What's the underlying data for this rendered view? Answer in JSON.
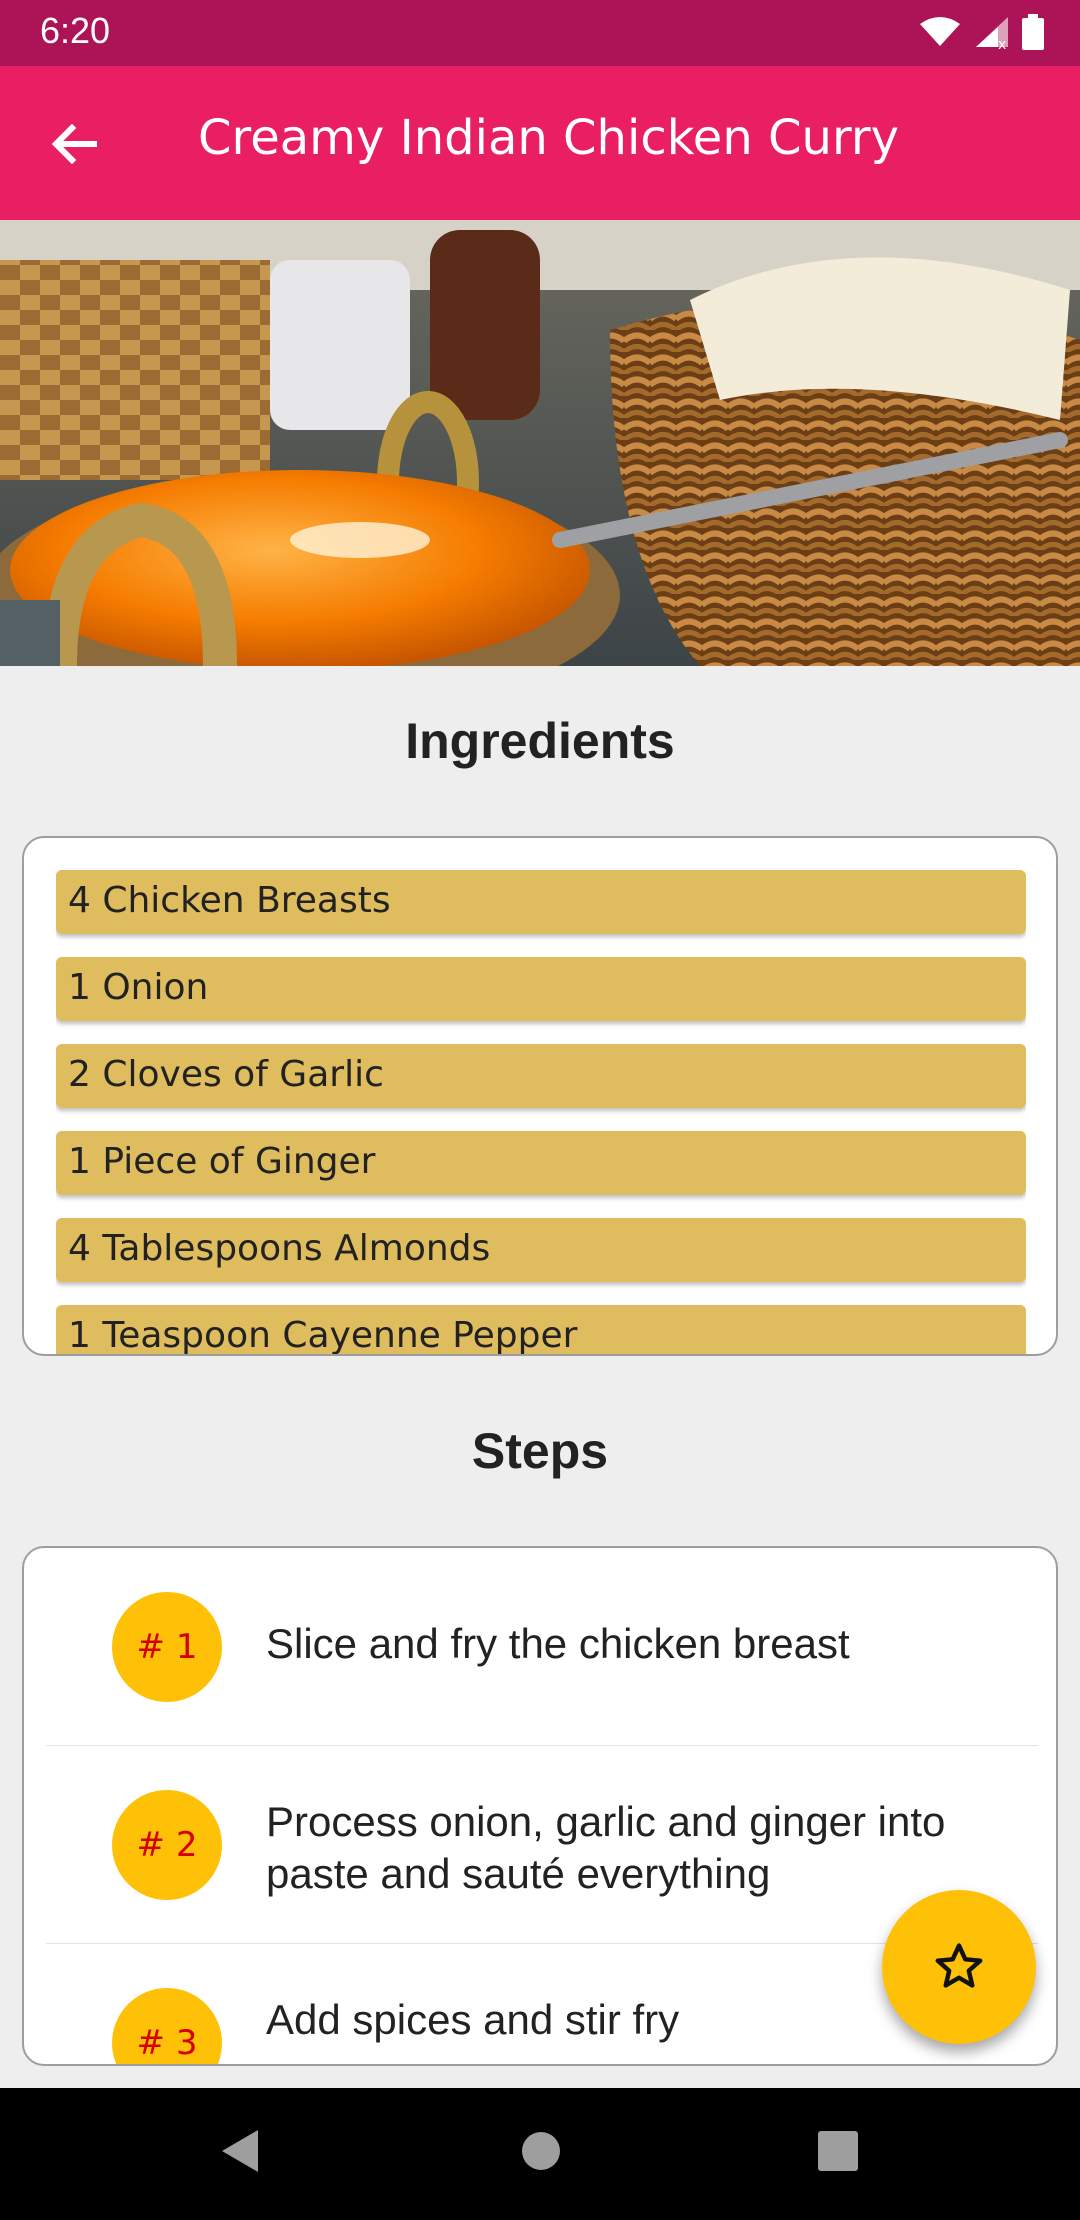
{
  "status_bar": {
    "time": "6:20",
    "icons": [
      "wifi-icon",
      "signal-icon",
      "battery-icon"
    ]
  },
  "app_bar": {
    "title": "Creamy Indian Chicken Curry",
    "back_icon": "arrow-back-icon",
    "color": "#e91e63",
    "status_color": "#ad1457"
  },
  "hero_image": {
    "description": "photo"
  },
  "ingredients": {
    "heading": "Ingredients",
    "items": [
      "4 Chicken Breasts",
      "1 Onion",
      "2 Cloves of Garlic",
      "1 Piece of Ginger",
      "4 Tablespoons Almonds",
      "1 Teaspoon Cayenne Pepper"
    ],
    "item_color": "#dfbd5e"
  },
  "steps": {
    "heading": "Steps",
    "items": [
      {
        "number": "# 1",
        "text": "Slice and fry the chicken breast"
      },
      {
        "number": "# 2",
        "text": "Process onion, garlic and ginger into paste and sauté everything"
      },
      {
        "number": "# 3",
        "text": "Add spices and stir fry"
      }
    ],
    "badge_color": "#ffc107",
    "number_color": "#d50000"
  },
  "fab": {
    "icon": "star-outline-icon",
    "color": "#ffc107"
  },
  "nav_bar": {
    "icons": [
      "back-triangle-icon",
      "home-circle-icon",
      "recents-square-icon"
    ]
  }
}
